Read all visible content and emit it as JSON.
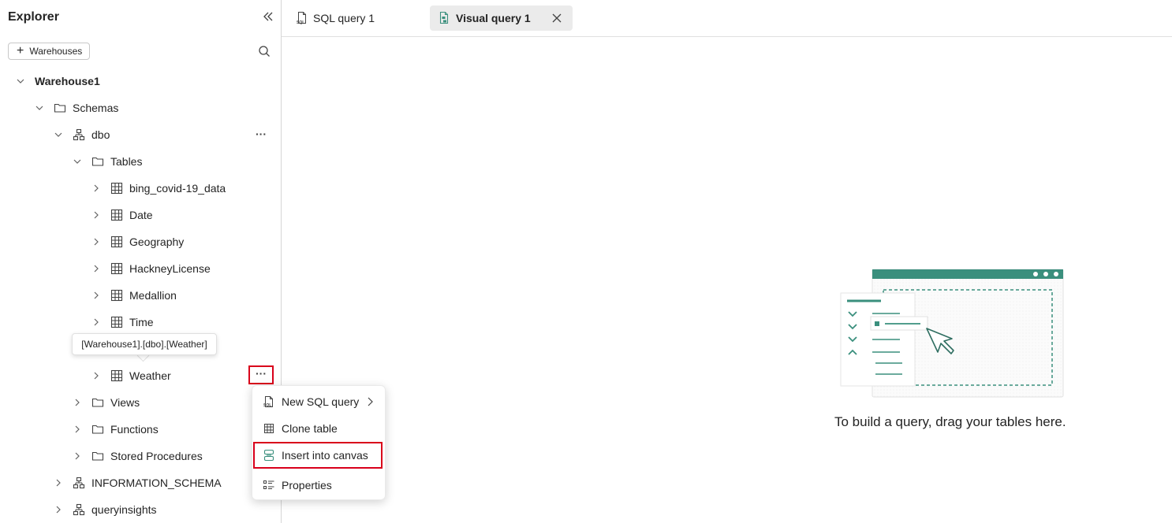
{
  "sidebar": {
    "title": "Explorer",
    "warehouses_button": "Warehouses",
    "tree": {
      "warehouse": "Warehouse1",
      "schemas": "Schemas",
      "dbo": "dbo",
      "tables": "Tables",
      "table_items": [
        "bing_covid-19_data",
        "Date",
        "Geography",
        "HackneyLicense",
        "Medallion",
        "Time",
        "Weather"
      ],
      "views": "Views",
      "functions": "Functions",
      "stored_procedures": "Stored Procedures",
      "information_schema": "INFORMATION_SCHEMA",
      "queryinsights": "queryinsights"
    },
    "tooltip": "[Warehouse1].[dbo].[Weather]"
  },
  "context_menu": {
    "items": [
      "New SQL query",
      "Clone table",
      "Insert into canvas",
      "Properties"
    ]
  },
  "tabs": [
    {
      "label": "SQL query 1",
      "icon": "sql-file-icon"
    },
    {
      "label": "Visual query 1",
      "icon": "visual-query-icon"
    }
  ],
  "canvas": {
    "message": "To build a query, drag your tables here."
  },
  "colors": {
    "accent_teal": "#3a8f7d",
    "highlight_red": "#d9001b"
  }
}
